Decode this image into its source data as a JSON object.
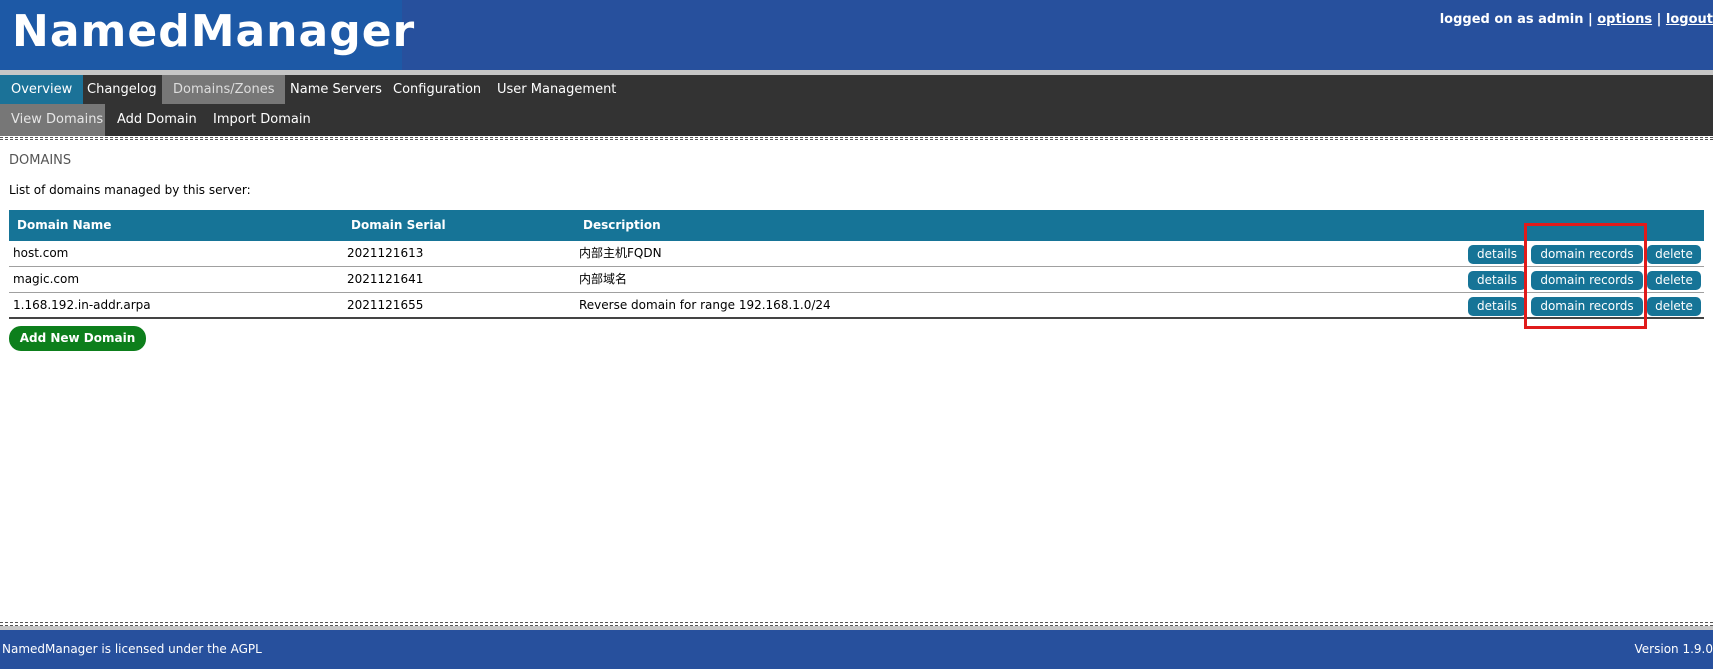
{
  "app": {
    "title": "NamedManager"
  },
  "userbar": {
    "prefix": "logged on as admin | ",
    "options_label": "options",
    "separator": " | ",
    "logout_label": "logout"
  },
  "nav": {
    "items": [
      {
        "label": "Overview",
        "state": "active"
      },
      {
        "label": "Changelog",
        "state": "normal"
      },
      {
        "label": "Domains/Zones",
        "state": "selected"
      },
      {
        "label": "Name Servers",
        "state": "normal"
      },
      {
        "label": "Configuration",
        "state": "normal"
      },
      {
        "label": "User Management",
        "state": "normal"
      }
    ]
  },
  "subnav": {
    "items": [
      {
        "label": "View Domains",
        "state": "selected"
      },
      {
        "label": "Add Domain",
        "state": "normal"
      },
      {
        "label": "Import Domain",
        "state": "normal"
      }
    ]
  },
  "main": {
    "section_title": "DOMAINS",
    "intro": "List of domains managed by this server:",
    "table": {
      "headers": [
        "Domain Name",
        "Domain Serial",
        "Description"
      ],
      "rows": [
        {
          "name": "host.com",
          "serial": "2021121613",
          "description": "内部主机FQDN"
        },
        {
          "name": "magic.com",
          "serial": "2021121641",
          "description": "内部域名"
        },
        {
          "name": "1.168.192.in-addr.arpa",
          "serial": "2021121655",
          "description": "Reverse domain for range 192.168.1.0/24"
        }
      ],
      "row_actions": {
        "details": "details",
        "records": "domain records",
        "delete": "delete"
      }
    },
    "add_button": "Add New Domain"
  },
  "footer": {
    "license": "NamedManager is licensed under the AGPL",
    "version": "Version 1.9.0"
  },
  "colors": {
    "header_blue": "#27509d",
    "nav_dark": "#333333",
    "accent_teal": "#167497",
    "add_green": "#0d7f1c",
    "highlight_red": "#e01b1b"
  }
}
